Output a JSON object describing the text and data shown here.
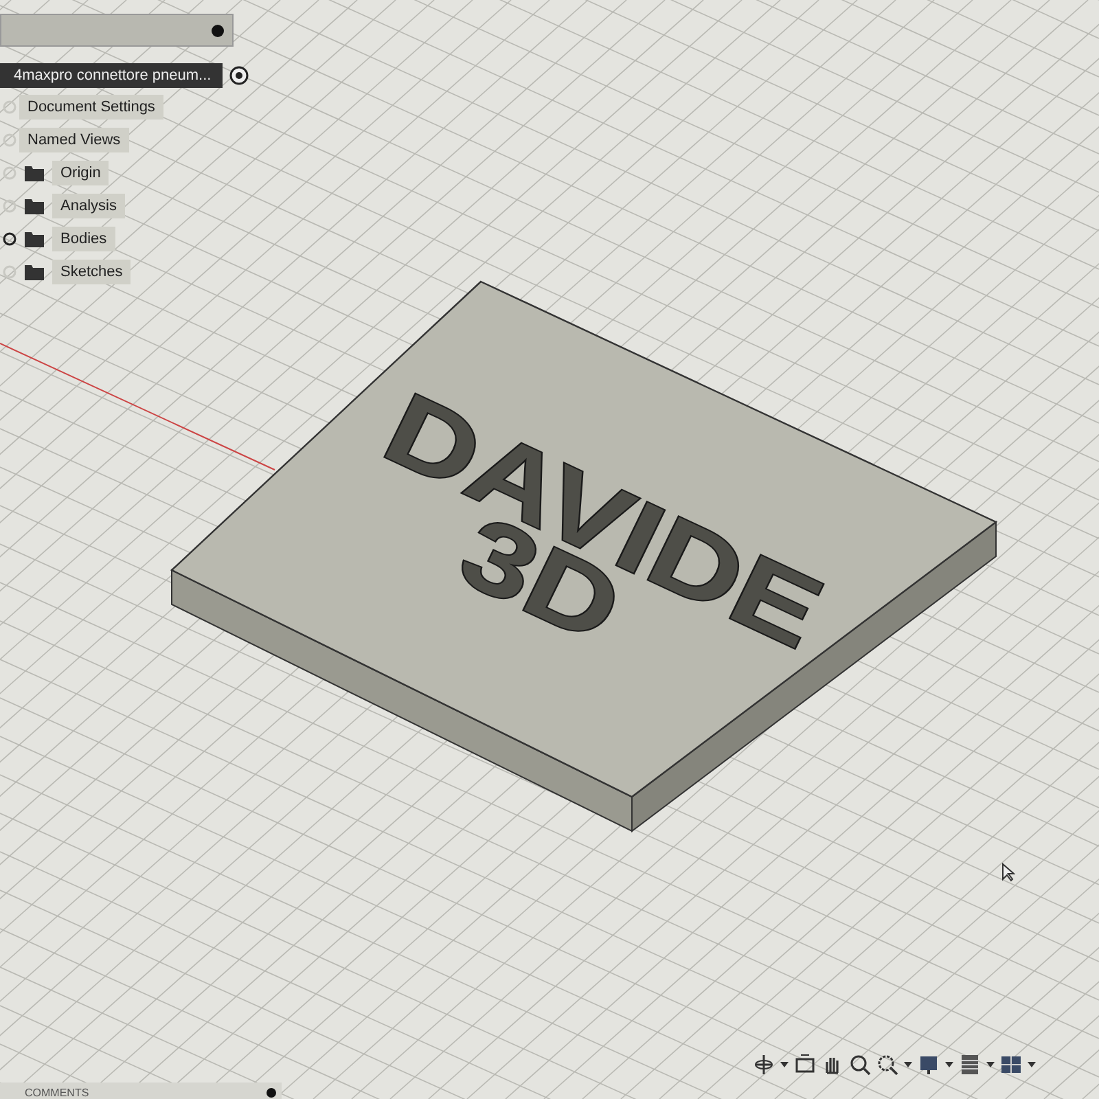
{
  "browser": {
    "title": "4maxpro connettore pneum...",
    "items": [
      {
        "label": "Document Settings",
        "kind": "plain",
        "visible": false
      },
      {
        "label": "Named Views",
        "kind": "plain",
        "visible": false
      },
      {
        "label": "Origin",
        "kind": "folder",
        "visible": false
      },
      {
        "label": "Analysis",
        "kind": "folder",
        "visible": false
      },
      {
        "label": "Bodies",
        "kind": "folder",
        "visible": true
      },
      {
        "label": "Sketches",
        "kind": "folder",
        "visible": false
      }
    ]
  },
  "model_text": [
    "DAVIDE",
    "3D"
  ],
  "comments": {
    "label": "COMMENTS"
  }
}
